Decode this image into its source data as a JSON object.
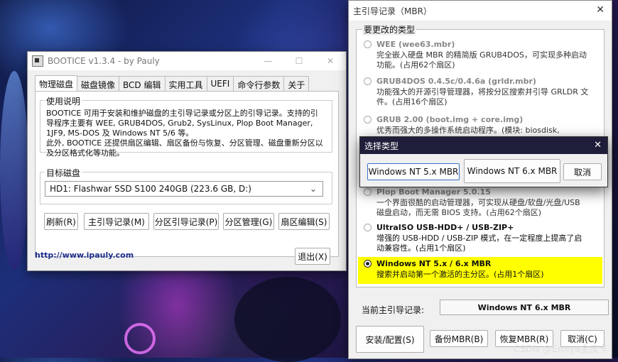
{
  "bootice": {
    "title": "BOOTICE v1.3.4 - by Pauly",
    "window_controls": {
      "minimize": "—",
      "maximize": "☐",
      "close": "✕"
    },
    "tabs": [
      "物理磁盘",
      "磁盘镜像",
      "BCD 编辑",
      "实用工具",
      "UEFI",
      "命令行参数",
      "关于"
    ],
    "usage": {
      "label": "使用说明",
      "lines": [
        "BOOTICE 可用于安装和维护磁盘的主引导记录或分区上的引导记录。支持的引导程序主要有 WEE, GRUB4DOS, Grub2, SysLinux, Plop Boot Manager, 1JF9, MS-DOS 及 Windows NT 5/6 等。",
        "此外, BOOTICE 还提供扇区编辑、扇区备份与恢复、分区管理、磁盘重新分区以及分区格式化等功能。"
      ]
    },
    "target": {
      "label": "目标磁盘",
      "value": "HD1: Flashwar SSD S100 240GB (223.6 GB, D:)"
    },
    "buttons": {
      "refresh": "刷新(R)",
      "mbr": "主引导记录(M)",
      "pbr": "分区引导记录(P)",
      "partition": "分区管理(G)",
      "sector": "扇区编辑(S)",
      "exit": "退出(X)"
    },
    "link": "http://www.ipauly.com"
  },
  "mbr": {
    "title": "主引导记录（MBR）",
    "close": "✕",
    "types_label": "要更改的类型",
    "options": [
      {
        "title": "WEE (wee63.mbr)",
        "desc": "完全嵌入硬盘 MBR 的精简版 GRUB4DOS，可实现多种启动功能。(占用62个扇区)",
        "selected": false
      },
      {
        "title": "GRUB4DOS 0.4.5c/0.4.6a (grldr.mbr)",
        "desc": "功能强大的开源引导管理器，将按分区搜索并引导 GRLDR 文件。(占用16个扇区)",
        "selected": false
      },
      {
        "title": "GRUB 2.00 (boot.img + core.img)",
        "desc": "优秀而强大的多操作系统启动程序。(模块: biosdisk,",
        "selected": false
      },
      {
        "title": "Plop Boot Manager 5.0.15",
        "desc": "一个界面很酷的启动管理器，可实现从硬盘/软盘/光盘/USB 磁盘启动，而无需 BIOS 支持。(占用62个扇区)",
        "selected": false
      },
      {
        "title": "UltraISO USB-HDD+ / USB-ZIP+",
        "desc": "增强的 USB-HDD / USB-ZIP 模式，在一定程度上提高了启动兼容性。(占用1个扇区)",
        "selected": false
      },
      {
        "title": "Windows NT 5.x / 6.x MBR",
        "desc": "搜索并启动第一个激活的主分区。(占用1个扇区)",
        "selected": true
      }
    ],
    "current_label": "当前主引导记录:",
    "current_value": "Windows NT 6.x MBR",
    "buttons": {
      "install": "安装/配置(S)",
      "backup": "备份MBR(B)",
      "restore": "恢复MBR(R)",
      "cancel": "取消(C)"
    }
  },
  "select_type": {
    "title": "选择类型",
    "close": "✕",
    "buttons": {
      "nt5": "Windows NT 5.x MBR",
      "nt6": "Windows NT 6.x MBR",
      "cancel": "取消"
    }
  },
  "watermark": "CSDN @Emiya金皮卡",
  "colors": {
    "highlight": "#ffff00",
    "link": "#1a2a8a"
  }
}
